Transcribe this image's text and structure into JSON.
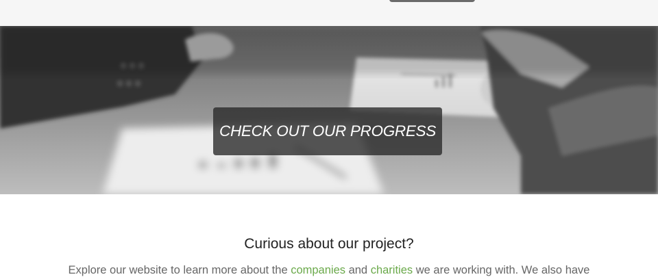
{
  "hero": {
    "button_label": "CHECK OUT OUR PROGRESS",
    "image_tone": "grayscale"
  },
  "intro": {
    "heading": "Curious about our project?",
    "text_part1": "Explore our website to learn more about the ",
    "link_companies": "companies",
    "text_part2": " and ",
    "link_charities": "charities",
    "text_part3": " we are working with. We also have"
  },
  "colors": {
    "top_band": "#f6f6f6",
    "button_overlay": "#2f2f2f",
    "link": "#6aa94a",
    "heading": "#222222",
    "body_text": "#666666"
  }
}
